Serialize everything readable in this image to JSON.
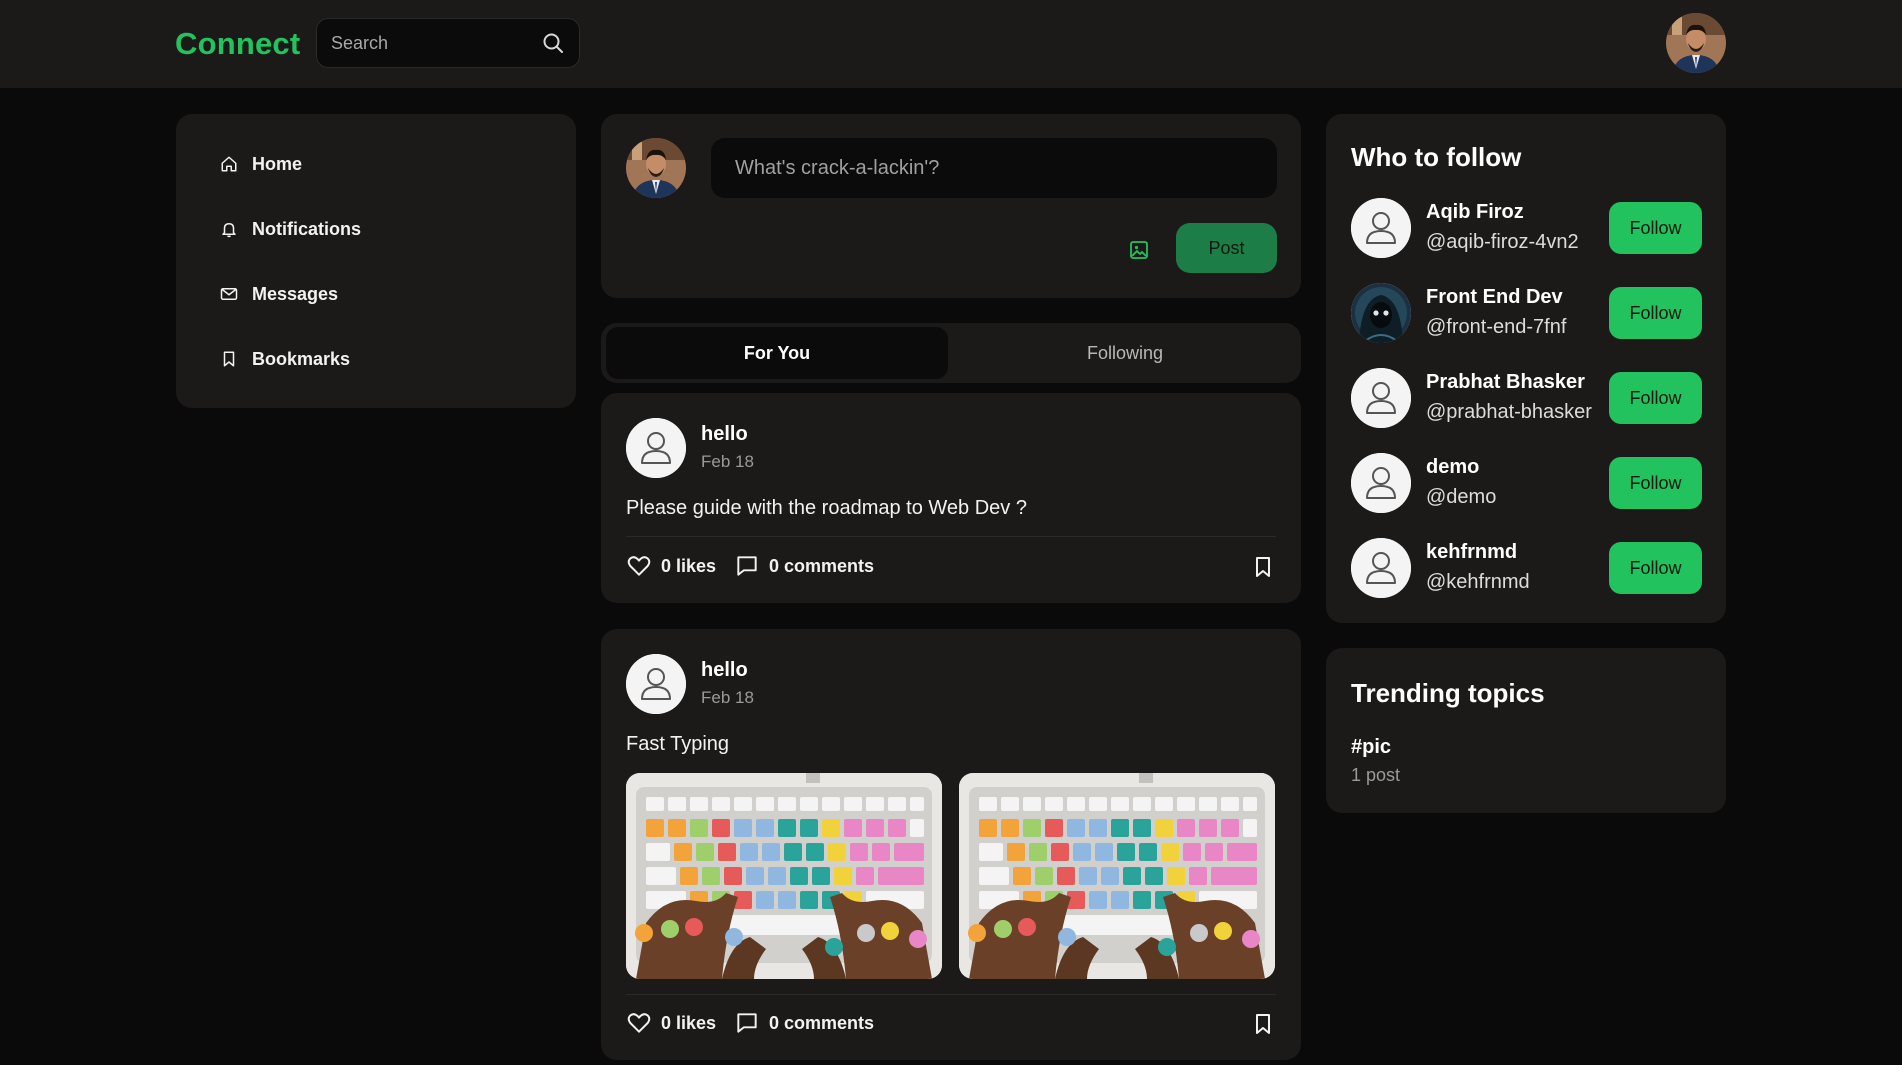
{
  "app": {
    "logo": "Connect",
    "accent": "#22c35e"
  },
  "search": {
    "placeholder": "Search"
  },
  "nav": {
    "items": [
      {
        "label": "Home",
        "icon": "home-icon"
      },
      {
        "label": "Notifications",
        "icon": "bell-icon"
      },
      {
        "label": "Messages",
        "icon": "mail-icon"
      },
      {
        "label": "Bookmarks",
        "icon": "bookmark-icon"
      }
    ]
  },
  "composer": {
    "placeholder": "What's crack-a-lackin'?",
    "post_label": "Post"
  },
  "tabs": [
    {
      "label": "For You",
      "active": true
    },
    {
      "label": "Following",
      "active": false
    }
  ],
  "posts": [
    {
      "author": "hello",
      "date": "Feb 18",
      "text": "Please guide with the roadmap to Web Dev ?",
      "likes": "0 likes",
      "comments": "0 comments"
    },
    {
      "author": "hello",
      "date": "Feb 18",
      "text": "Fast Typing",
      "likes": "0 likes",
      "comments": "0 comments",
      "images": 2
    }
  ],
  "who_to_follow": {
    "title": "Who to follow",
    "follow_label": "Follow",
    "users": [
      {
        "name": "Aqib Firoz",
        "handle": "@aqib-firoz-4vn2"
      },
      {
        "name": "Front End Dev",
        "handle": "@front-end-7fnf"
      },
      {
        "name": "Prabhat Bhasker",
        "handle": "@prabhat-bhasker"
      },
      {
        "name": "demo",
        "handle": "@demo"
      },
      {
        "name": "kehfrnmd",
        "handle": "@kehfrnmd"
      }
    ]
  },
  "trending": {
    "title": "Trending topics",
    "topics": [
      {
        "tag": "#pic",
        "count": "1 post"
      }
    ]
  }
}
